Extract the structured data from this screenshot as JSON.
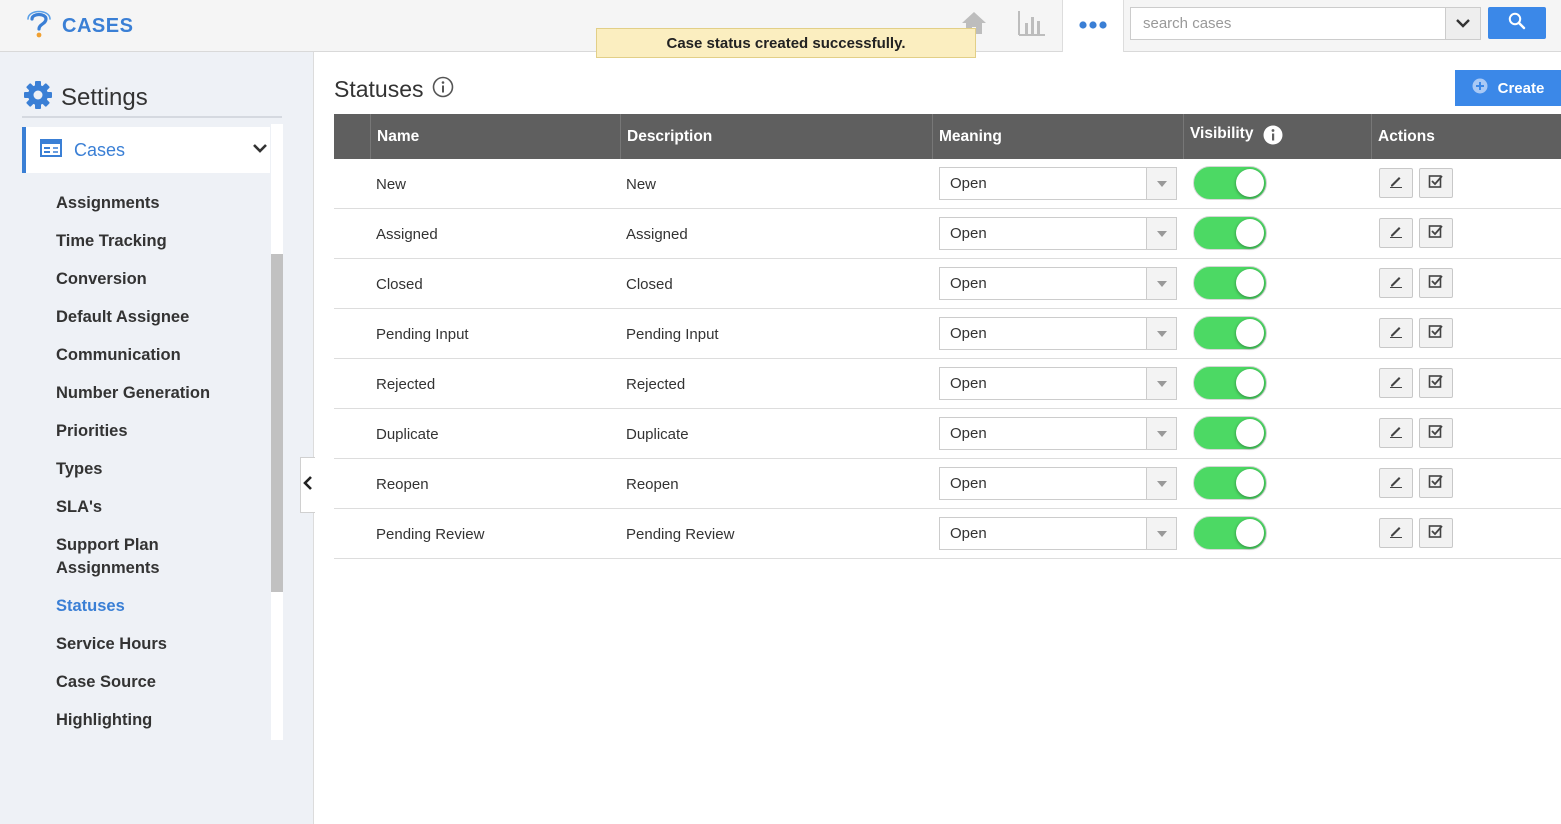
{
  "app": {
    "title": "CASES"
  },
  "toast": {
    "message": "Case status created successfully."
  },
  "search": {
    "placeholder": "search cases"
  },
  "icons": {
    "logo": "question-mark-logo-icon",
    "home": "home-icon",
    "reports": "bar-chart-icon",
    "more": "more-dots-icon",
    "search": "search-icon",
    "settings": "gear-icon",
    "cases": "cases-list-icon",
    "chevron": "chevron-down-icon",
    "collapse": "chevron-left-icon",
    "info": "info-icon",
    "create": "plus-circle-icon",
    "edit": "pencil-icon",
    "check": "checkbox-icon",
    "dropdown": "caret-down-icon"
  },
  "colors": {
    "accent": "#3a7fd5",
    "button": "#3b88e8",
    "toggle_on": "#4cd964",
    "header_bg": "#5f5f5f",
    "toast_bg": "#fbeec0"
  },
  "sidebar": {
    "title": "Settings",
    "section": "Cases",
    "items": [
      {
        "label": "Assignments",
        "active": false
      },
      {
        "label": "Time Tracking",
        "active": false
      },
      {
        "label": "Conversion",
        "active": false
      },
      {
        "label": "Default Assignee",
        "active": false
      },
      {
        "label": "Communication",
        "active": false
      },
      {
        "label": "Number Generation",
        "active": false
      },
      {
        "label": "Priorities",
        "active": false
      },
      {
        "label": "Types",
        "active": false
      },
      {
        "label": "SLA's",
        "active": false
      },
      {
        "label": "Support Plan Assignments",
        "active": false
      },
      {
        "label": "Statuses",
        "active": true
      },
      {
        "label": "Service Hours",
        "active": false
      },
      {
        "label": "Case Source",
        "active": false
      },
      {
        "label": "Highlighting",
        "active": false
      }
    ]
  },
  "main": {
    "title": "Statuses",
    "create_label": "Create",
    "columns": {
      "name": "Name",
      "description": "Description",
      "meaning": "Meaning",
      "visibility": "Visibility",
      "actions": "Actions"
    },
    "rows": [
      {
        "name": "New",
        "description": "New",
        "meaning": "Open",
        "visible": true
      },
      {
        "name": "Assigned",
        "description": "Assigned",
        "meaning": "Open",
        "visible": true
      },
      {
        "name": "Closed",
        "description": "Closed",
        "meaning": "Open",
        "visible": true
      },
      {
        "name": "Pending Input",
        "description": "Pending Input",
        "meaning": "Open",
        "visible": true
      },
      {
        "name": "Rejected",
        "description": "Rejected",
        "meaning": "Open",
        "visible": true
      },
      {
        "name": "Duplicate",
        "description": "Duplicate",
        "meaning": "Open",
        "visible": true
      },
      {
        "name": "Reopen",
        "description": "Reopen",
        "meaning": "Open",
        "visible": true
      },
      {
        "name": "Pending Review",
        "description": "Pending Review",
        "meaning": "Open",
        "visible": true
      }
    ]
  }
}
